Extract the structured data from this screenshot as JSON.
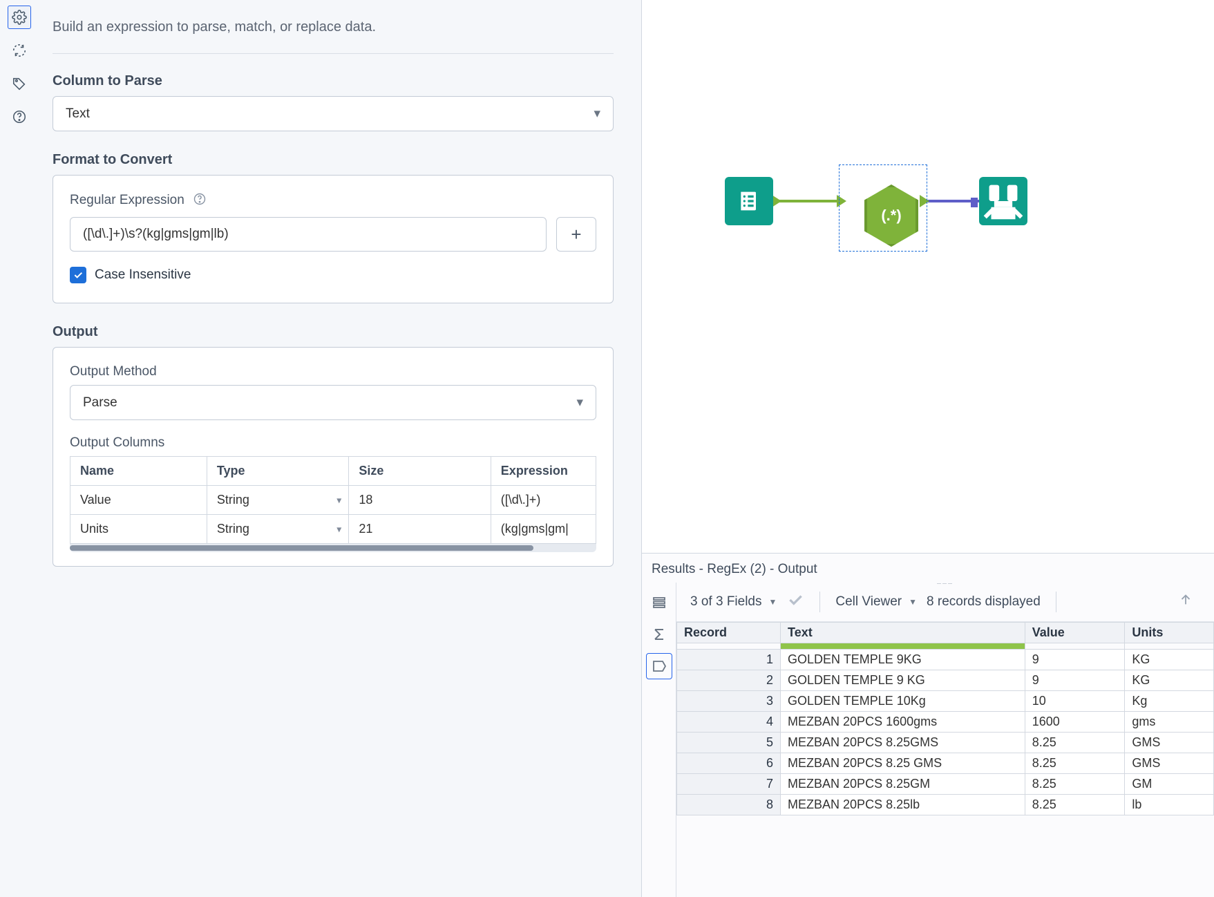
{
  "config": {
    "description": "Build an expression to parse, match, or replace data.",
    "column_to_parse_label": "Column to Parse",
    "column_to_parse_value": "Text",
    "format_to_convert_label": "Format to Convert",
    "regex_label": "Regular Expression",
    "regex_value": "([\\d\\.]+)\\s?(kg|gms|gm|lb)",
    "case_insensitive_label": "Case Insensitive",
    "case_insensitive_checked": true,
    "output_label": "Output",
    "output_method_label": "Output Method",
    "output_method_value": "Parse",
    "output_columns_label": "Output Columns",
    "oc_headers": {
      "name": "Name",
      "type": "Type",
      "size": "Size",
      "expr": "Expression"
    },
    "oc_rows": [
      {
        "name": "Value",
        "type": "String",
        "size": "18",
        "expr": "([\\d\\.]+)"
      },
      {
        "name": "Units",
        "type": "String",
        "size": "21",
        "expr": "(kg|gms|gm|"
      }
    ]
  },
  "canvas": {
    "regex_node_label": "(.*)"
  },
  "results": {
    "title": "Results - RegEx (2) - Output",
    "fields_summary": "3 of 3 Fields",
    "cell_viewer_label": "Cell Viewer",
    "records_displayed": "8 records displayed",
    "columns": {
      "record": "Record",
      "text": "Text",
      "value": "Value",
      "units": "Units"
    },
    "rows": [
      {
        "record": "1",
        "text": "GOLDEN TEMPLE 9KG",
        "value": "9",
        "units": "KG"
      },
      {
        "record": "2",
        "text": "GOLDEN TEMPLE 9 KG",
        "value": "9",
        "units": "KG"
      },
      {
        "record": "3",
        "text": "GOLDEN TEMPLE 10Kg",
        "value": "10",
        "units": "Kg"
      },
      {
        "record": "4",
        "text": "MEZBAN 20PCS 1600gms",
        "value": "1600",
        "units": "gms"
      },
      {
        "record": "5",
        "text": "MEZBAN 20PCS 8.25GMS",
        "value": "8.25",
        "units": "GMS"
      },
      {
        "record": "6",
        "text": "MEZBAN 20PCS 8.25 GMS",
        "value": "8.25",
        "units": "GMS"
      },
      {
        "record": "7",
        "text": "MEZBAN 20PCS 8.25GM",
        "value": "8.25",
        "units": "GM"
      },
      {
        "record": "8",
        "text": "MEZBAN 20PCS 8.25lb",
        "value": "8.25",
        "units": "lb"
      }
    ]
  }
}
